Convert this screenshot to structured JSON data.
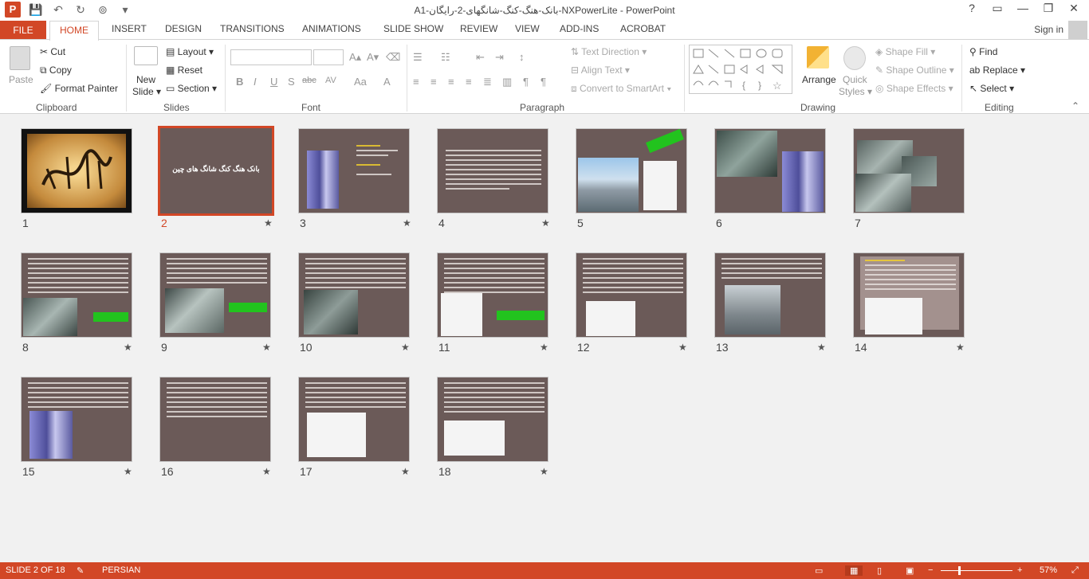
{
  "window": {
    "title": "A1-بانک-هنگ-کنگ-شانگهای-2-رایگان-NXPowerLite - PowerPoint",
    "controls": [
      "?",
      "▭",
      "—",
      "❐",
      "✕"
    ]
  },
  "qat": {
    "logo": "P",
    "save": "💾",
    "undo": "↶",
    "redo": "↻",
    "present": "⊚",
    "more": "▾"
  },
  "tabs": [
    "FILE",
    "HOME",
    "INSERT",
    "DESIGN",
    "TRANSITIONS",
    "ANIMATIONS",
    "SLIDE SHOW",
    "REVIEW",
    "VIEW",
    "ADD-INS",
    "ACROBAT"
  ],
  "signin": "Sign in",
  "ribbon": {
    "clipboard": {
      "paste": "Paste",
      "cut": "Cut",
      "copy": "Copy",
      "format_painter": "Format Painter",
      "label": "Clipboard"
    },
    "slides": {
      "new_slide": "New",
      "new_slide2": "Slide ▾",
      "layout": "Layout ▾",
      "reset": "Reset",
      "section": "Section ▾",
      "label": "Slides"
    },
    "font": {
      "label": "Font",
      "bold": "B",
      "italic": "I",
      "underline": "U",
      "shadow": "S",
      "strike": "abc",
      "spacing": "AV",
      "case": "Aa",
      "color": "A"
    },
    "paragraph": {
      "label": "Paragraph",
      "text_direction": "Text Direction ▾",
      "align_text": "Align Text ▾",
      "smartart": "Convert to SmartArt ▾"
    },
    "drawing": {
      "label": "Drawing",
      "arrange": "Arrange",
      "quick_styles": "Quick",
      "quick_styles2": "Styles ▾",
      "shape_fill": "Shape Fill ▾",
      "shape_outline": "Shape Outline ▾",
      "shape_effects": "Shape Effects ▾"
    },
    "editing": {
      "label": "Editing",
      "find": "Find",
      "replace": "Replace ▾",
      "select": "Select ▾"
    }
  },
  "slides": [
    {
      "n": "1",
      "selected": false,
      "star": ""
    },
    {
      "n": "2",
      "selected": true,
      "star": "",
      "title": "بانک هنگ کنگ شانگ های چین"
    },
    {
      "n": "3",
      "selected": false,
      "star": "★"
    },
    {
      "n": "4",
      "selected": false,
      "star": "★"
    },
    {
      "n": "5",
      "selected": false,
      "star": "★"
    },
    {
      "n": "6",
      "selected": false,
      "star": ""
    },
    {
      "n": "7",
      "selected": false,
      "star": ""
    },
    {
      "n": "8",
      "selected": false,
      "star": "★"
    },
    {
      "n": "9",
      "selected": false,
      "star": "★"
    },
    {
      "n": "10",
      "selected": false,
      "star": "★"
    },
    {
      "n": "11",
      "selected": false,
      "star": "★"
    },
    {
      "n": "12",
      "selected": false,
      "star": "★"
    },
    {
      "n": "13",
      "selected": false,
      "star": "★"
    },
    {
      "n": "14",
      "selected": false,
      "star": "★"
    },
    {
      "n": "15",
      "selected": false,
      "star": "★"
    },
    {
      "n": "16",
      "selected": false,
      "star": "★"
    },
    {
      "n": "17",
      "selected": false,
      "star": "★"
    },
    {
      "n": "18",
      "selected": false,
      "star": "★"
    }
  ],
  "status": {
    "slide": "SLIDE 2 OF 18",
    "language": "PERSIAN",
    "zoom": "57%"
  },
  "colors": {
    "accent": "#d24726",
    "slide_bg": "#6b5a58",
    "green_label": "#22c31e"
  }
}
